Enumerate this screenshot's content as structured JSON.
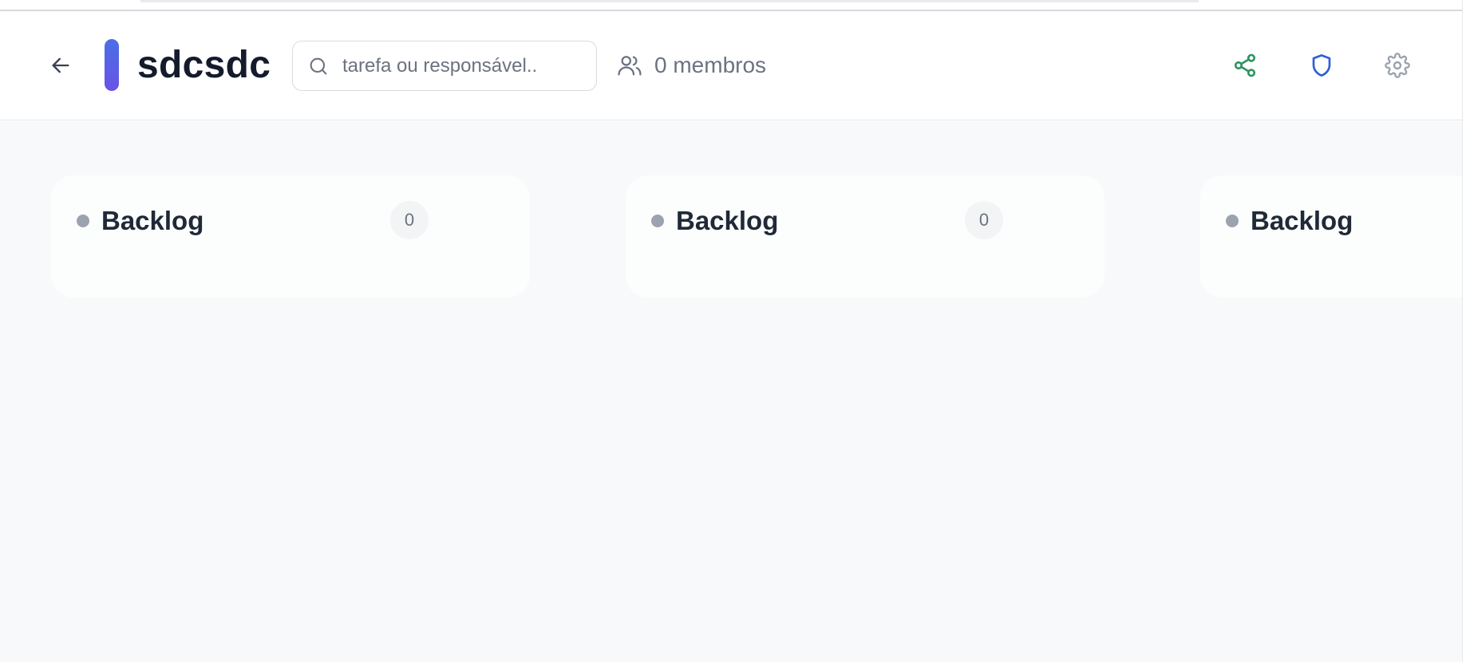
{
  "project": {
    "title": "sdcsdc",
    "accent_gradient": [
      "#4a6fe6",
      "#6a52e6"
    ]
  },
  "search": {
    "placeholder": "tarefa ou responsável..",
    "value": ""
  },
  "members": {
    "label": "0 membros"
  },
  "header_icons": {
    "back": "arrow-left-icon",
    "members": "users-icon",
    "share": "share-icon",
    "shield": "shield-icon",
    "settings": "gear-icon",
    "share_color": "#2f9461",
    "shield_color": "#2e5fd6",
    "settings_color": "#9ca3af"
  },
  "columns": [
    {
      "title": "Backlog",
      "count": "0"
    },
    {
      "title": "Backlog",
      "count": "0"
    },
    {
      "title": "Backlog",
      "count": ""
    }
  ]
}
